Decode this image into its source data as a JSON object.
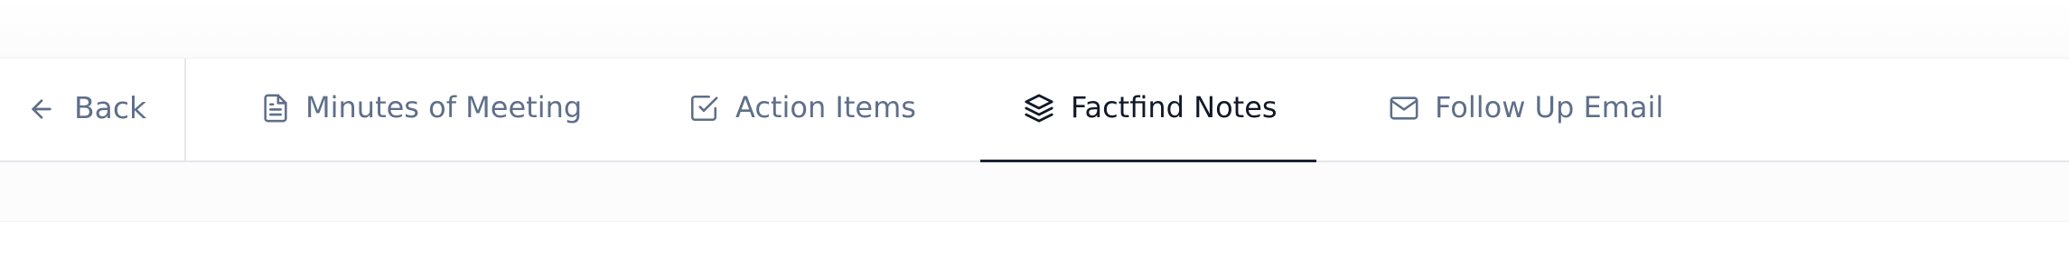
{
  "nav": {
    "back_label": "Back"
  },
  "tabs": [
    {
      "label": "Minutes of Meeting",
      "icon": "document-icon",
      "active": false
    },
    {
      "label": "Action Items",
      "icon": "checkbox-icon",
      "active": false
    },
    {
      "label": "Factfind Notes",
      "icon": "layers-icon",
      "active": true
    },
    {
      "label": "Follow Up Email",
      "icon": "mail-icon",
      "active": false
    }
  ],
  "colors": {
    "inactive_text": "#5f6f89",
    "active_text": "#111827",
    "active_underline": "#1b2233",
    "divider": "#e4e6ea"
  }
}
